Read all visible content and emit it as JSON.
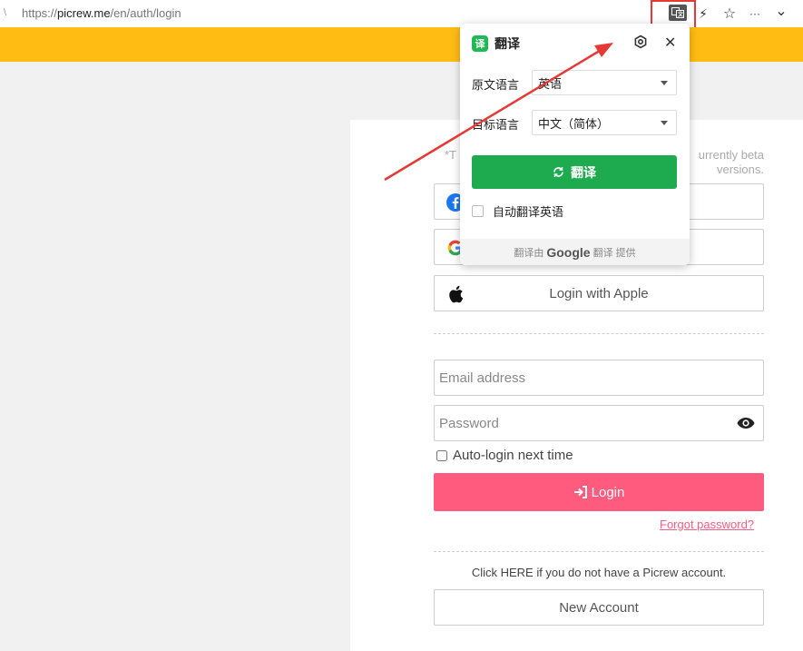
{
  "browser": {
    "url_prefix": "https://",
    "url_host": "picrew.me",
    "url_path": "/en/auth/login",
    "lead_glyph": "\\",
    "icons": [
      "translate-extension-icon",
      "lightning-icon",
      "star-icon",
      "more-icon",
      "chevron-down-icon"
    ],
    "lightning": "⚡",
    "star": "☆",
    "more": "···",
    "chevron": "⌄"
  },
  "notice": {
    "left_fragment": "*T",
    "right_line1": "urrently beta",
    "right_line2": "versions."
  },
  "social": {
    "apple_label": "Login with Apple"
  },
  "form": {
    "email_placeholder": "Email address",
    "password_placeholder": "Password",
    "autologin_label": "Auto-login next time",
    "login_label": "Login",
    "forgot_label": "Forgot password?",
    "no_account_text": "Click HERE if you do not have a Picrew account.",
    "new_account_label": "New Account"
  },
  "translate_popup": {
    "logo_char": "译",
    "title": "翻译",
    "close": "✕",
    "source_label": "原文语言",
    "source_value": "英语",
    "target_label": "目标语言",
    "target_value": "中文（简体）",
    "translate_button": "翻译",
    "auto_translate_label": "自动翻译英语",
    "footer_prefix": "翻译由",
    "footer_brand": "Google",
    "footer_suffix": "翻译 提供"
  },
  "colors": {
    "banner": "#ffbc13",
    "login_button": "#ff5b7f",
    "translate_button": "#1eaa4e",
    "annotation": "#e53935"
  }
}
